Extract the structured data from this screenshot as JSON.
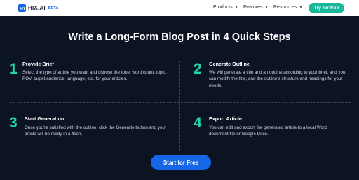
{
  "header": {
    "logo_text": "HIX.AI",
    "beta_badge": "BETA",
    "nav": [
      {
        "label": "Products"
      },
      {
        "label": "Features"
      },
      {
        "label": "Resources"
      }
    ],
    "try_button": "Try for free"
  },
  "main": {
    "title": "Write a Long-Form Blog Post in 4 Quick Steps",
    "steps": [
      {
        "number": "1",
        "title": "Provide Brief",
        "desc": "Select the type of article you want and choose the tone, word count, topic, POV, target audience, language, etc. for your articles."
      },
      {
        "number": "2",
        "title": "Generate Outline",
        "desc": "We will generate a title and an outline according to your brief, and you can modify the title, and the outline's structure and headings for your needs."
      },
      {
        "number": "3",
        "title": "Start Generation",
        "desc": "Once you're satisfied with the outline, click the Generate button and your article will be ready in a flash."
      },
      {
        "number": "4",
        "title": "Export Article",
        "desc": "You can edit and export the generated article to a local Word document file or Google Docs."
      }
    ],
    "cta": "Start for Free"
  },
  "colors": {
    "background": "#0c1424",
    "accent_teal": "#1fd6b0",
    "primary_blue": "#1566e8",
    "try_button": "#18b89b"
  }
}
